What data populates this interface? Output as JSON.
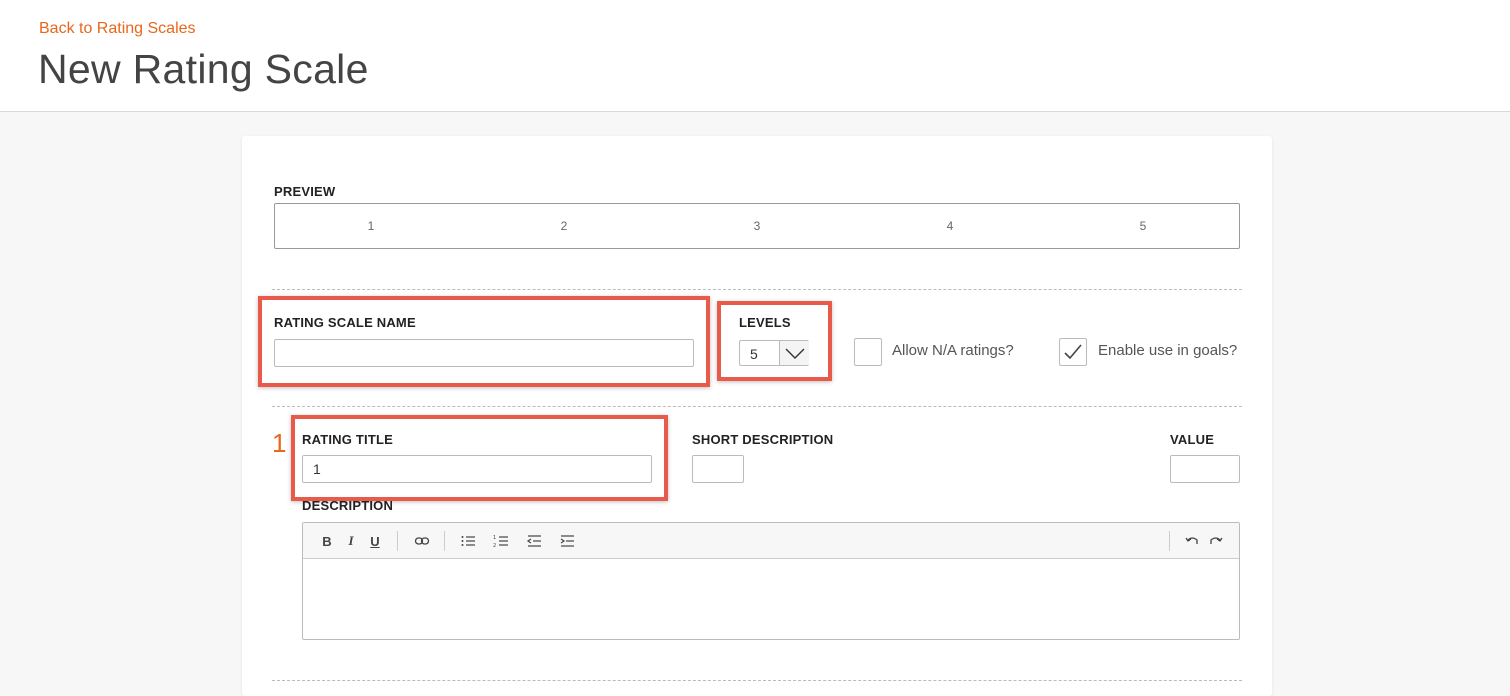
{
  "header": {
    "back_link": "Back to Rating Scales",
    "title": "New Rating Scale"
  },
  "accent_color": "#e8671c",
  "highlight_color": "#e85b4a",
  "preview": {
    "label": "PREVIEW",
    "items": [
      "1",
      "2",
      "3",
      "4",
      "5"
    ]
  },
  "scale": {
    "name_label": "RATING SCALE NAME",
    "name_value": "",
    "levels_label": "LEVELS",
    "levels_value": "5",
    "allow_na_label": "Allow N/A ratings?",
    "allow_na_checked": false,
    "goals_label": "Enable use in goals?",
    "goals_checked": true
  },
  "rating": {
    "number": "1",
    "title_label": "RATING TITLE",
    "title_value": "1",
    "short_desc_label": "SHORT DESCRIPTION",
    "short_desc_value": "",
    "value_label": "VALUE",
    "value_value": "",
    "description_label": "DESCRIPTION"
  },
  "toolbar": {
    "buttons": [
      "bold-icon",
      "italic-icon",
      "underline-icon",
      "link-icon",
      "bullet-list-icon",
      "numbered-list-icon",
      "outdent-icon",
      "indent-icon",
      "undo-icon",
      "redo-icon"
    ]
  }
}
